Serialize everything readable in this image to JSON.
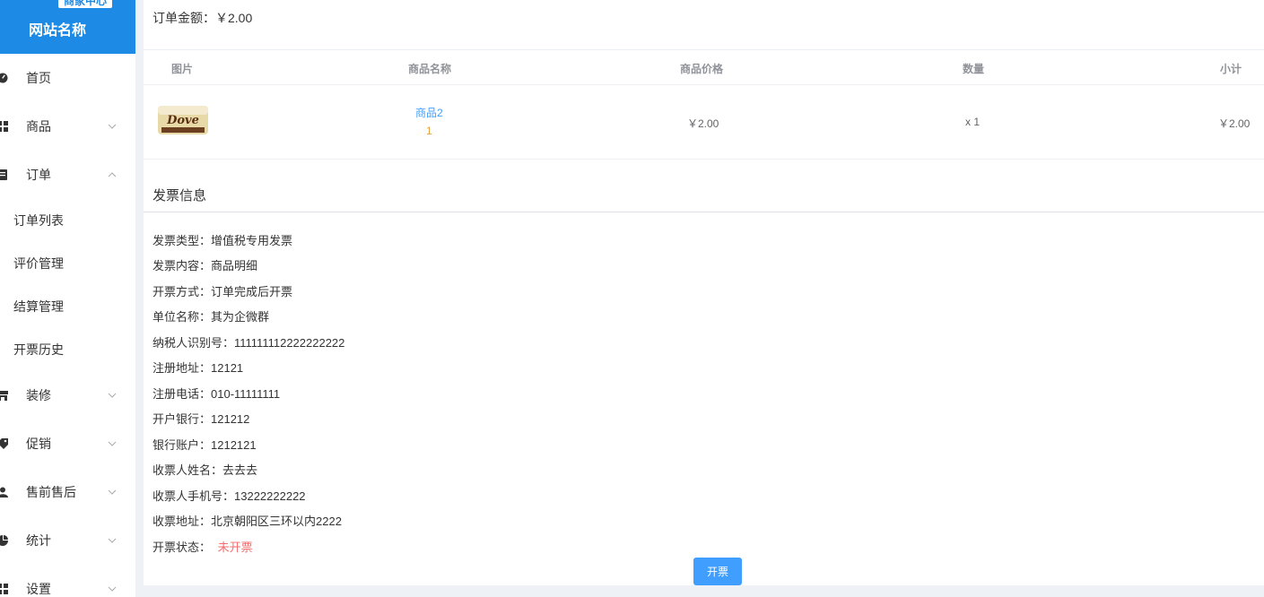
{
  "sidebar": {
    "badge": "商家中心",
    "brand": "网站名称",
    "nav": [
      {
        "label": "首页",
        "icon": "dashboard-icon",
        "has_chevron": false
      },
      {
        "label": "商品",
        "icon": "grid-icon",
        "has_chevron": true,
        "chevron": "down"
      },
      {
        "label": "订单",
        "icon": "order-icon",
        "has_chevron": true,
        "chevron": "up"
      }
    ],
    "sub_items": [
      {
        "label": "订单列表"
      },
      {
        "label": "评价管理"
      },
      {
        "label": "结算管理"
      },
      {
        "label": "开票历史"
      }
    ],
    "nav_bottom": [
      {
        "label": "装修",
        "icon": "store-icon",
        "chevron": "down"
      },
      {
        "label": "促销",
        "icon": "tag-icon",
        "chevron": "down"
      },
      {
        "label": "售前售后",
        "icon": "user-icon",
        "chevron": "down"
      },
      {
        "label": "统计",
        "icon": "pie-chart-icon",
        "chevron": "down"
      },
      {
        "label": "设置",
        "icon": "grid-icon",
        "chevron": "down"
      }
    ]
  },
  "order": {
    "amount_text": "订单金额：￥2.00"
  },
  "table": {
    "headers": [
      "图片",
      "商品名称",
      "商品价格",
      "数量",
      "小计"
    ],
    "rows": [
      {
        "image": "Dove",
        "name": "商品2",
        "spec": "1",
        "price": "￥2.00",
        "qty": "x 1",
        "subtotal": "￥2.00"
      }
    ]
  },
  "invoice": {
    "title": "发票信息",
    "lines": [
      "发票类型：增值税专用发票",
      "发票内容：商品明细",
      "开票方式：订单完成后开票",
      "单位名称：其为企微群",
      "纳税人识别号：111111112222222222",
      "注册地址：12121",
      "注册电话：010-11111111",
      "开户银行：121212",
      "银行账户：1212121",
      "收票人姓名：去去去",
      "收票人手机号：13222222222",
      "收票地址：北京朝阳区三环以内2222"
    ],
    "status_label": "开票状态：",
    "status_value": "未开票",
    "status_color": "#f56c6c",
    "button_label": "开票"
  },
  "colors": {
    "brand": "#1d8ae6",
    "primary": "#409eff",
    "background": "#eef1f5"
  }
}
